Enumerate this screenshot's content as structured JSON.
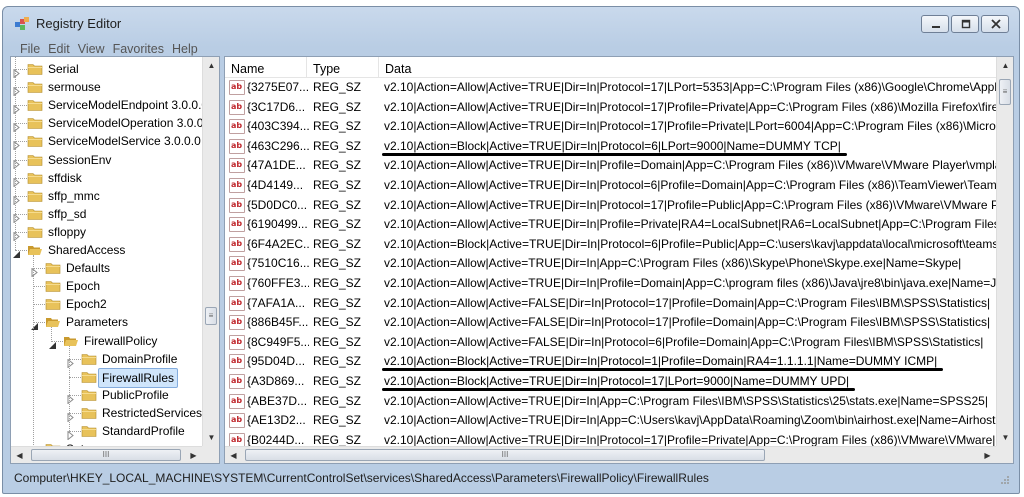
{
  "window": {
    "title": "Registry Editor"
  },
  "menu": [
    "File",
    "Edit",
    "View",
    "Favorites",
    "Help"
  ],
  "tree": {
    "items": [
      {
        "label": "Serial",
        "level": 0,
        "expander": "collapsed"
      },
      {
        "label": "sermouse",
        "level": 0,
        "expander": "collapsed"
      },
      {
        "label": "ServiceModelEndpoint 3.0.0.0",
        "level": 0,
        "expander": "collapsed"
      },
      {
        "label": "ServiceModelOperation 3.0.0.",
        "level": 0,
        "expander": "collapsed"
      },
      {
        "label": "ServiceModelService 3.0.0.0",
        "level": 0,
        "expander": "collapsed"
      },
      {
        "label": "SessionEnv",
        "level": 0,
        "expander": "collapsed"
      },
      {
        "label": "sffdisk",
        "level": 0,
        "expander": "collapsed"
      },
      {
        "label": "sffp_mmc",
        "level": 0,
        "expander": "collapsed"
      },
      {
        "label": "sffp_sd",
        "level": 0,
        "expander": "collapsed"
      },
      {
        "label": "sfloppy",
        "level": 0,
        "expander": "collapsed"
      },
      {
        "label": "SharedAccess",
        "level": 0,
        "expander": "expanded"
      },
      {
        "label": "Defaults",
        "level": 1,
        "expander": "collapsed"
      },
      {
        "label": "Epoch",
        "level": 1,
        "expander": "none"
      },
      {
        "label": "Epoch2",
        "level": 1,
        "expander": "none"
      },
      {
        "label": "Parameters",
        "level": 1,
        "expander": "expanded"
      },
      {
        "label": "FirewallPolicy",
        "level": 2,
        "expander": "expanded"
      },
      {
        "label": "DomainProfile",
        "level": 3,
        "expander": "collapsed"
      },
      {
        "label": "FirewallRules",
        "level": 3,
        "expander": "none",
        "selected": true
      },
      {
        "label": "PublicProfile",
        "level": 3,
        "expander": "collapsed"
      },
      {
        "label": "RestrictedServices",
        "level": 3,
        "expander": "collapsed"
      },
      {
        "label": "StandardProfile",
        "level": 3,
        "expander": "collapsed"
      },
      {
        "label": "Setup",
        "level": 1,
        "expander": "collapsed"
      }
    ]
  },
  "list": {
    "columns": [
      "Name",
      "Type",
      "Data"
    ],
    "rows": [
      {
        "name": "{3275E07...",
        "type": "REG_SZ",
        "data": "v2.10|Action=Allow|Active=TRUE|Dir=In|Protocol=17|LPort=5353|App=C:\\Program Files (x86)\\Google\\Chrome\\Application\\chrome.exe|"
      },
      {
        "name": "{3C17D6...",
        "type": "REG_SZ",
        "data": "v2.10|Action=Allow|Active=TRUE|Dir=In|Protocol=17|Profile=Private|App=C:\\Program Files (x86)\\Mozilla Firefox\\firefox.exe|"
      },
      {
        "name": "{403C394...",
        "type": "REG_SZ",
        "data": "v2.10|Action=Allow|Active=TRUE|Dir=In|Protocol=17|Profile=Private|LPort=6004|App=C:\\Program Files (x86)\\Microsoft Office|"
      },
      {
        "name": "{463C296...",
        "type": "REG_SZ",
        "data": "v2.10|Action=Block|Active=TRUE|Dir=In|Protocol=6|LPort=9000|Name=DUMMY TCP|",
        "underline": true
      },
      {
        "name": "{47A1DE...",
        "type": "REG_SZ",
        "data": "v2.10|Action=Allow|Active=TRUE|Dir=In|Profile=Domain|App=C:\\Program Files (x86)\\VMware\\VMware Player\\vmplayer.exe|"
      },
      {
        "name": "{4D4149...",
        "type": "REG_SZ",
        "data": "v2.10|Action=Allow|Active=TRUE|Dir=In|Protocol=6|Profile=Domain|App=C:\\Program Files (x86)\\TeamViewer\\TeamViewer.exe|"
      },
      {
        "name": "{5D0DC0...",
        "type": "REG_SZ",
        "data": "v2.10|Action=Allow|Active=TRUE|Dir=In|Protocol=17|Profile=Public|App=C:\\Program Files (x86)\\VMware\\VMware Player|"
      },
      {
        "name": "{6190499...",
        "type": "REG_SZ",
        "data": "v2.10|Action=Allow|Active=TRUE|Dir=In|Profile=Private|RA4=LocalSubnet|RA6=LocalSubnet|App=C:\\Program Files|"
      },
      {
        "name": "{6F4A2EC...",
        "type": "REG_SZ",
        "data": "v2.10|Action=Block|Active=TRUE|Dir=In|Protocol=6|Profile=Public|App=C:\\users\\kavj\\appdata\\local\\microsoft\\teams|"
      },
      {
        "name": "{7510C16...",
        "type": "REG_SZ",
        "data": "v2.10|Action=Allow|Active=TRUE|Dir=In|App=C:\\Program Files (x86)\\Skype\\Phone\\Skype.exe|Name=Skype|"
      },
      {
        "name": "{760FFE3...",
        "type": "REG_SZ",
        "data": "v2.10|Action=Allow|Active=TRUE|Dir=In|Profile=Domain|App=C:\\program files (x86)\\Java\\jre8\\bin\\java.exe|Name=Java|"
      },
      {
        "name": "{7AFA1A...",
        "type": "REG_SZ",
        "data": "v2.10|Action=Allow|Active=FALSE|Dir=In|Protocol=17|Profile=Domain|App=C:\\Program Files\\IBM\\SPSS\\Statistics|"
      },
      {
        "name": "{886B45F...",
        "type": "REG_SZ",
        "data": "v2.10|Action=Allow|Active=FALSE|Dir=In|Protocol=17|Profile=Domain|App=C:\\Program Files\\IBM\\SPSS\\Statistics|"
      },
      {
        "name": "{8C949F5...",
        "type": "REG_SZ",
        "data": "v2.10|Action=Allow|Active=FALSE|Dir=In|Protocol=6|Profile=Domain|App=C:\\Program Files\\IBM\\SPSS\\Statistics|"
      },
      {
        "name": "{95D04D...",
        "type": "REG_SZ",
        "data": "v2.10|Action=Block|Active=TRUE|Dir=In|Protocol=1|Profile=Domain|RA4=1.1.1.1|Name=DUMMY ICMP|",
        "underline": true
      },
      {
        "name": "{A3D869...",
        "type": "REG_SZ",
        "data": "v2.10|Action=Block|Active=TRUE|Dir=In|Protocol=17|LPort=9000|Name=DUMMY UPD|",
        "underline": true
      },
      {
        "name": "{ABE37D...",
        "type": "REG_SZ",
        "data": "v2.10|Action=Allow|Active=TRUE|Dir=In|App=C:\\Program Files\\IBM\\SPSS\\Statistics\\25\\stats.exe|Name=SPSS25|"
      },
      {
        "name": "{AE13D2...",
        "type": "REG_SZ",
        "data": "v2.10|Action=Allow|Active=TRUE|Dir=In|App=C:\\Users\\kavj\\AppData\\Roaming\\Zoom\\bin\\airhost.exe|Name=Airhost|"
      },
      {
        "name": "{B0244D...",
        "type": "REG_SZ",
        "data": "v2.10|Action=Allow|Active=TRUE|Dir=In|Protocol=17|Profile=Private|App=C:\\Program Files (x86)\\VMware\\VMware|"
      }
    ]
  },
  "statusbar": {
    "path": "Computer\\HKEY_LOCAL_MACHINE\\SYSTEM\\CurrentControlSet\\services\\SharedAccess\\Parameters\\FirewallPolicy\\FirewallRules"
  },
  "scroll": {
    "tree_vertical_thumb_glyph": "≡",
    "tree_horizontal_thumb_glyph": "III",
    "list_horizontal_thumb_glyph": "III",
    "list_vertical_thumb_glyph": "≡"
  },
  "colors": {
    "selection_bg": "#cfe5fb",
    "selection_border": "#84acdd",
    "folder": "#e8c25a",
    "window_frame": "#b9cde4"
  }
}
